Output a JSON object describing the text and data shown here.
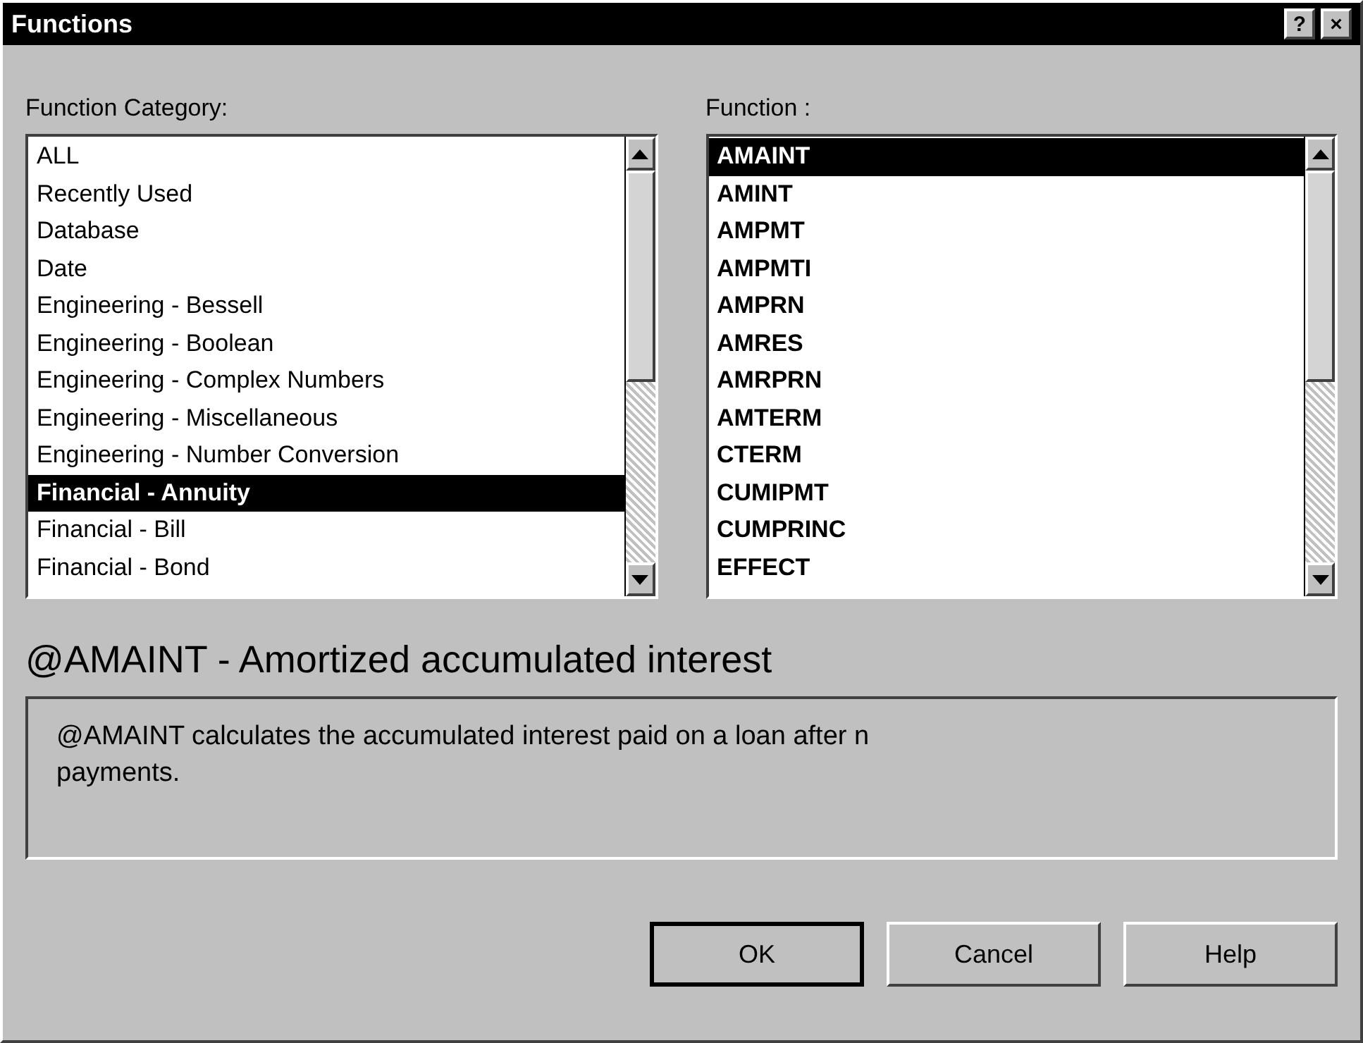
{
  "window": {
    "title": "Functions",
    "title_buttons": [
      "?",
      "×"
    ]
  },
  "category_list": {
    "label": "Function Category:",
    "items": [
      {
        "label": "ALL",
        "selected": false
      },
      {
        "label": "Recently Used",
        "selected": false
      },
      {
        "label": "Database",
        "selected": false
      },
      {
        "label": "Date",
        "selected": false
      },
      {
        "label": "Engineering - Bessell",
        "selected": false
      },
      {
        "label": "Engineering - Boolean",
        "selected": false
      },
      {
        "label": "Engineering - Complex Numbers",
        "selected": false
      },
      {
        "label": "Engineering - Miscellaneous",
        "selected": false
      },
      {
        "label": "Engineering - Number Conversion",
        "selected": false
      },
      {
        "label": "Financial - Annuity",
        "selected": true
      },
      {
        "label": "Financial - Bill",
        "selected": false
      },
      {
        "label": "Financial - Bond",
        "selected": false
      }
    ]
  },
  "function_list": {
    "label": "Function :",
    "items": [
      {
        "label": "AMAINT",
        "selected": true
      },
      {
        "label": "AMINT",
        "selected": false
      },
      {
        "label": "AMPMT",
        "selected": false
      },
      {
        "label": "AMPMTI",
        "selected": false
      },
      {
        "label": "AMPRN",
        "selected": false
      },
      {
        "label": "AMRES",
        "selected": false
      },
      {
        "label": "AMRPRN",
        "selected": false
      },
      {
        "label": "AMTERM",
        "selected": false
      },
      {
        "label": "CTERM",
        "selected": false
      },
      {
        "label": "CUMIPMT",
        "selected": false
      },
      {
        "label": "CUMPRINC",
        "selected": false
      },
      {
        "label": "EFFECT",
        "selected": false
      }
    ]
  },
  "function_heading": "@AMAINT - Amortized accumulated interest",
  "description": "@AMAINT calculates the accumulated interest paid on a loan after n payments.",
  "buttons": [
    {
      "label": "OK",
      "default": true
    },
    {
      "label": "Cancel",
      "default": false
    },
    {
      "label": "Help",
      "default": false
    }
  ]
}
